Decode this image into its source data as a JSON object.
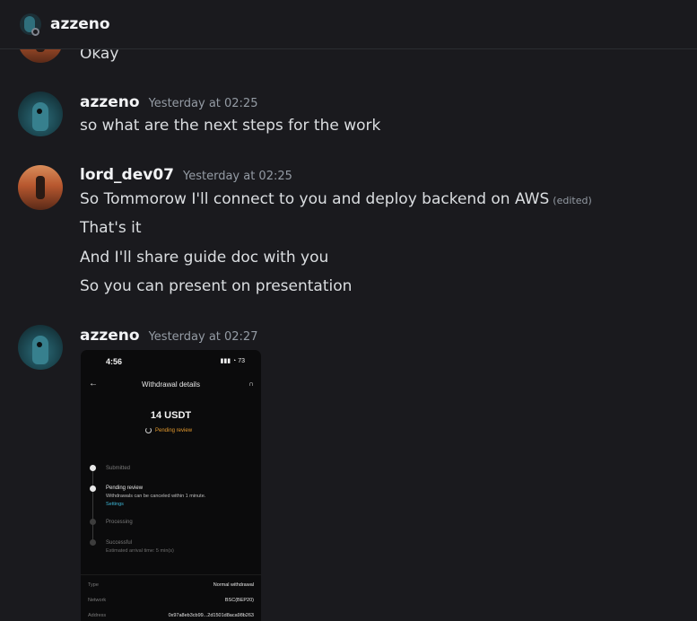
{
  "header": {
    "channel_name": "azzeno"
  },
  "messages": {
    "partial_top": {
      "text": "Okay"
    },
    "m1": {
      "username": "azzeno",
      "timestamp": "Yesterday at 02:25",
      "lines": [
        "so what are the next steps for the work"
      ]
    },
    "m2": {
      "username": "lord_dev07",
      "timestamp": "Yesterday at 02:25",
      "lines": [
        "So Tommorow I'll connect to you and deploy backend on AWS",
        "That's it",
        "And I'll share guide doc with you",
        "So you can present on presentation"
      ],
      "edited_label": "(edited)"
    },
    "m3": {
      "username": "azzeno",
      "timestamp": "Yesterday at 02:27"
    }
  },
  "attachment": {
    "time": "4:56",
    "battery": "73",
    "title": "Withdrawal details",
    "amount": "14 USDT",
    "status": "Pending review",
    "steps": {
      "s1": "Submitted",
      "s2": "Pending review",
      "s2_sub": "Withdrawals can be canceled within 1 minute.",
      "s2_link": "Settings",
      "s3": "Processing",
      "s4": "Successful",
      "s4_sub": "Estimated arrival time: 5 min(s)"
    },
    "details": {
      "type_label": "Type",
      "type_value": "Normal withdrawal",
      "network_label": "Network",
      "network_value": "BSC(BEP20)",
      "address_label": "Address",
      "address_value": "0x97a8eb3cb99...2d1501d8aca98b263"
    }
  },
  "colors": {
    "background": "#1a1a1e",
    "pending": "#e59a2e",
    "link": "#3db6d6"
  }
}
